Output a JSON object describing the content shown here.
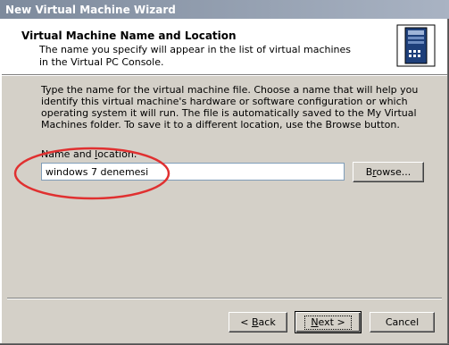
{
  "window": {
    "title": "New Virtual Machine Wizard"
  },
  "header": {
    "title": "Virtual Machine Name and Location",
    "subtitle": "The name you specify will appear in the list of virtual machines in the Virtual PC Console.",
    "icon": "server-tower-icon"
  },
  "body": {
    "description": "Type the name for the virtual machine file. Choose a name that will help you identify this virtual machine's hardware or software configuration or which operating system it will run. The file is automatically saved to the My Virtual Machines folder. To save it to a different location, use the Browse button.",
    "field_label_prefix": "Name and ",
    "field_label_access": "l",
    "field_label_suffix": "ocation:",
    "field_value": "windows 7 denemesi",
    "browse_prefix": "B",
    "browse_access": "r",
    "browse_suffix": "owse...",
    "annotation": "red-ellipse-highlight"
  },
  "footer": {
    "back_prefix": "< ",
    "back_access": "B",
    "back_suffix": "ack",
    "next_access": "N",
    "next_suffix": "ext >",
    "cancel_label": "Cancel"
  },
  "colors": {
    "annotation": "#e03030",
    "titlebar": "#8d98aa",
    "dialog_face": "#d4d0c8"
  }
}
